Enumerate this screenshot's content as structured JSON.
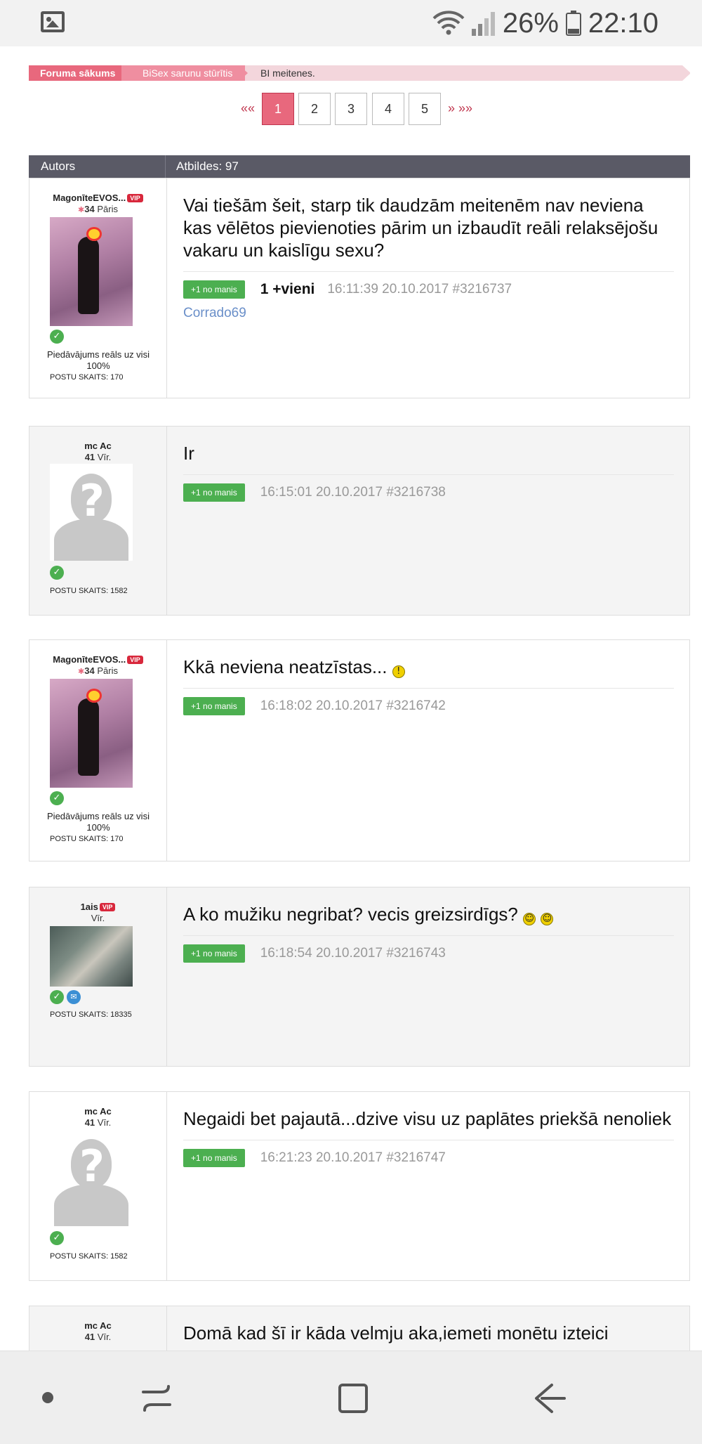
{
  "status_bar": {
    "battery": "26%",
    "time": "22:10",
    "icons": [
      "gallery-icon",
      "wifi-icon",
      "signal-icon",
      "battery-icon"
    ]
  },
  "breadcrumb": {
    "items": [
      "Foruma sākums",
      "BiSex sarunu stūrītis",
      "BI meitenes."
    ]
  },
  "pagination": {
    "prev": "««",
    "next": "» »»",
    "pages": [
      "1",
      "2",
      "3",
      "4",
      "5"
    ],
    "current": "1"
  },
  "table_header": {
    "author": "Autors",
    "replies": "Atbildes: 97"
  },
  "posts": [
    {
      "username": "MagonīteEVOS...",
      "vip": "VIP",
      "age": "34",
      "type": "Pāris",
      "offer": "Piedāvājums reāls uz visi 100%",
      "post_count": "POSTU SKAITS: 170",
      "message": "Vai tiešām šeit, starp tik daudzām meitenēm nav neviena kas vēlētos pievienoties pārim un izbaudīt reāli relaksējošu vakaru un kaislīgu sexu?",
      "plus_label": "+1 no manis",
      "reply_to": "1 +vieni",
      "timestamp": "16:11:39 20.10.2017 #3216737",
      "liked_by": "Corrado69"
    },
    {
      "username": "mc Ac",
      "age": "41",
      "type": "Vīr.",
      "post_count": "POSTU SKAITS: 1582",
      "message": "Ir",
      "plus_label": "+1 no manis",
      "timestamp": "16:15:01 20.10.2017 #3216738"
    },
    {
      "username": "MagonīteEVOS...",
      "vip": "VIP",
      "age": "34",
      "type": "Pāris",
      "offer": "Piedāvājums reāls uz visi 100%",
      "post_count": "POSTU SKAITS: 170",
      "message": "Kkā neviena neatzīstas...",
      "plus_label": "+1 no manis",
      "timestamp": "16:18:02 20.10.2017 #3216742"
    },
    {
      "username": "1ais",
      "vip": "VIP",
      "type": "Vīr.",
      "post_count": "POSTU SKAITS: 18335",
      "message": "A ko mužiku negribat? vecis greizsirdīgs?",
      "plus_label": "+1 no manis",
      "timestamp": "16:18:54 20.10.2017 #3216743"
    },
    {
      "username": "mc Ac",
      "age": "41",
      "type": "Vīr.",
      "post_count": "POSTU SKAITS: 1582",
      "message": "Negaidi bet pajautā...dzive visu uz paplātes priekšā nenoliek",
      "plus_label": "+1 no manis",
      "timestamp": "16:21:23 20.10.2017 #3216747"
    },
    {
      "username": "mc Ac",
      "age": "41",
      "type": "Vīr.",
      "message": "Domā kad šī ir kāda velmju aka,iemeti monētu izteici"
    }
  ],
  "nav_bar": {
    "icons": [
      "dot-icon",
      "recent-apps-icon",
      "home-icon",
      "back-icon"
    ]
  }
}
